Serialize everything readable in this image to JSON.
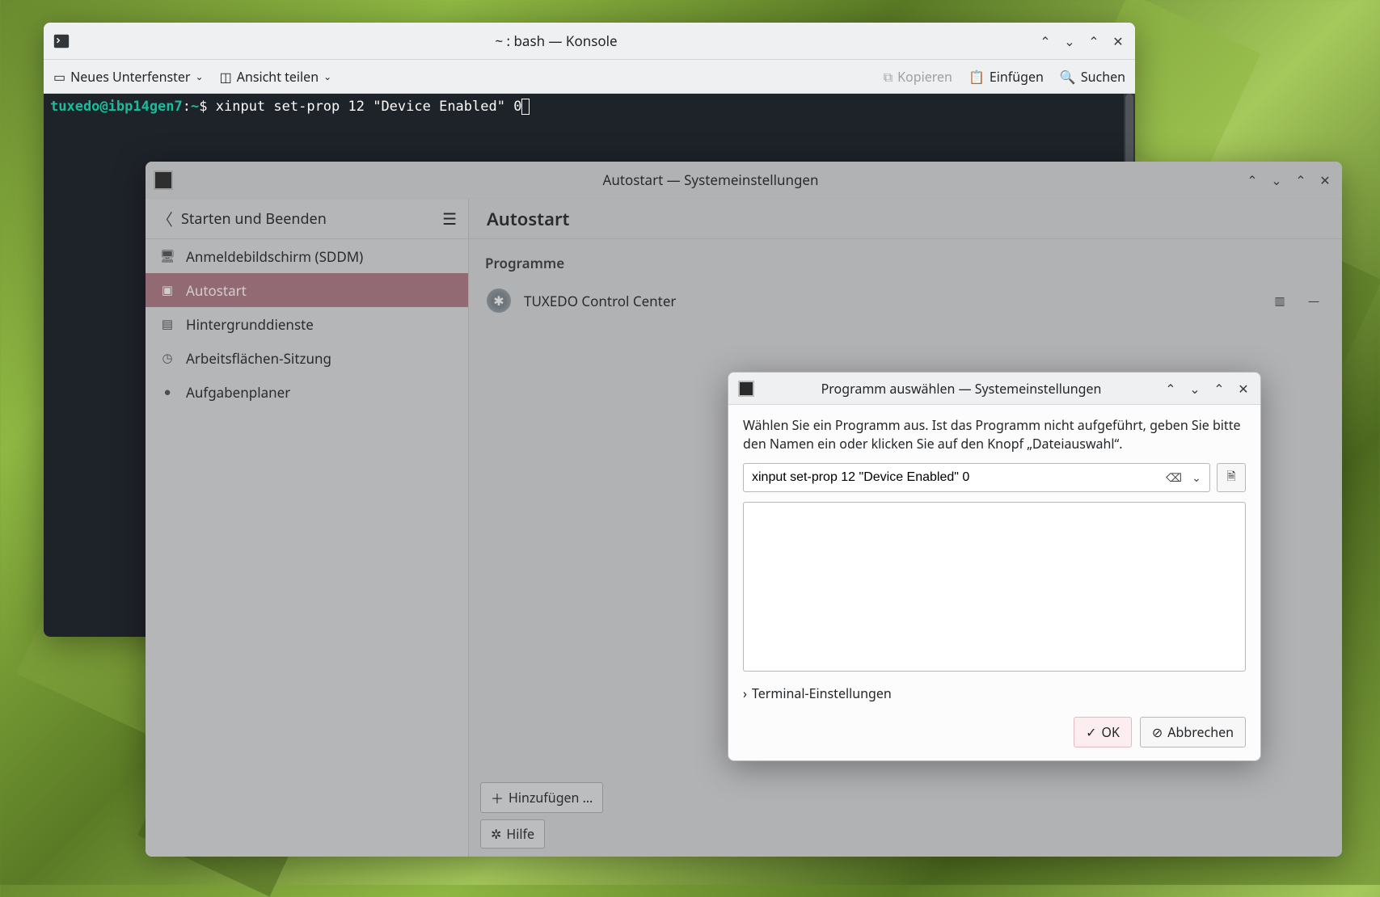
{
  "konsole": {
    "title": "~ : bash — Konsole",
    "toolbar": {
      "new_sub": "Neues Unterfenster",
      "split_view": "Ansicht teilen",
      "copy": "Kopieren",
      "paste": "Einfügen",
      "search": "Suchen"
    },
    "prompt": {
      "user_host": "tuxedo@ibp14gen7",
      "path": "~",
      "command": "xinput set-prop 12 \"Device Enabled\" 0"
    }
  },
  "settings": {
    "title": "Autostart — Systemeinstellungen",
    "breadcrumb": "Starten und Beenden",
    "sidebar": [
      {
        "label": "Anmeldebildschirm (SDDM)",
        "icon": "🖥"
      },
      {
        "label": "Autostart",
        "icon": "▣",
        "active": true
      },
      {
        "label": "Hintergrunddienste",
        "icon": "▤"
      },
      {
        "label": "Arbeitsflächen-Sitzung",
        "icon": "◷"
      },
      {
        "label": "Aufgabenplaner",
        "icon": "●"
      }
    ],
    "main_title": "Autostart",
    "section_programs": "Programme",
    "program_name": "TUXEDO Control Center",
    "add_label": "Hinzufügen …",
    "help_label": "Hilfe"
  },
  "dialog": {
    "title": "Programm auswählen — Systemeinstellungen",
    "instruction": "Wählen Sie ein Programm aus. Ist das Programm nicht aufgeführt, geben Sie bitte den Namen ein oder klicken Sie auf den Knopf „Dateiauswahl“.",
    "input_value": "xinput set-prop 12 \"Device Enabled\" 0",
    "terminal_settings": "Terminal-Einstellungen",
    "ok": "OK",
    "cancel": "Abbrechen"
  }
}
